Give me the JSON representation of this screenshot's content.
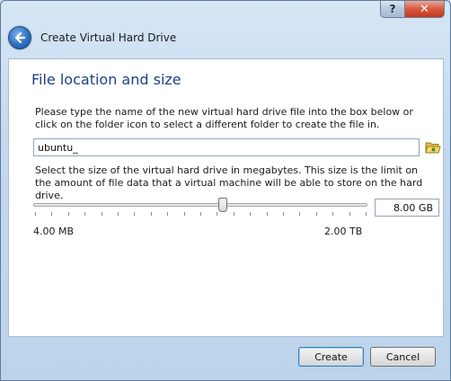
{
  "window": {
    "title": "Create Virtual Hard Drive",
    "help_glyph": "?",
    "close_glyph": "✕"
  },
  "page": {
    "heading": "File location and size",
    "location_description": "Please type the name of the new virtual hard drive file into the box below or click on the folder icon to select a different folder to create the file in.",
    "file_name_value": "ubuntu_",
    "size_description": "Select the size of the virtual hard drive in megabytes. This size is the limit on the amount of file data that a virtual machine will be able to store on the hard drive.",
    "size_value": "8.00 GB",
    "range_min_label": "4.00 MB",
    "range_max_label": "2.00 TB",
    "slider_fraction": 0.57
  },
  "footer": {
    "create_label": "Create",
    "cancel_label": "Cancel"
  },
  "icons": {
    "back": "back-arrow-icon",
    "folder": "folder-icon"
  },
  "colors": {
    "heading": "#1f3f8a",
    "close_button": "#c2391c"
  }
}
